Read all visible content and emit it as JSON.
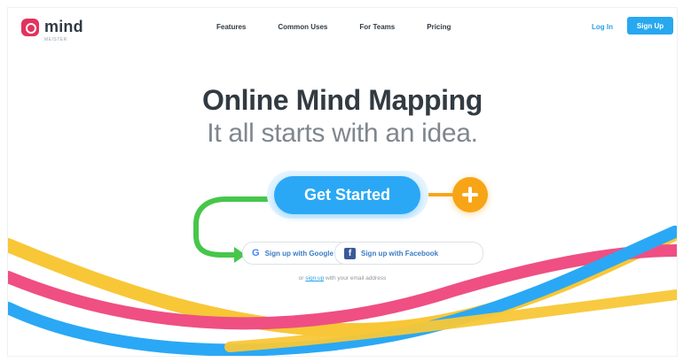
{
  "brand": {
    "name": "mind",
    "sub": "MEISTER"
  },
  "nav": {
    "items": [
      "Features",
      "Common Uses",
      "For Teams",
      "Pricing"
    ],
    "login": "Log In",
    "signup": "Sign Up"
  },
  "hero": {
    "title": "Online Mind Mapping",
    "subtitle": "It all starts with an idea.",
    "cta": "Get Started"
  },
  "social": {
    "google": "Sign up with Google",
    "facebook": "Sign up with Facebook",
    "google_icon": "G",
    "facebook_icon": "f"
  },
  "email": {
    "prefix": "or",
    "link": "sign up",
    "suffix": "with your email address"
  },
  "colors": {
    "blue": "#2aa8f5",
    "orange": "#f7a516",
    "green": "#46c64b",
    "pink": "#ef4f83",
    "yellow": "#f8c737"
  }
}
